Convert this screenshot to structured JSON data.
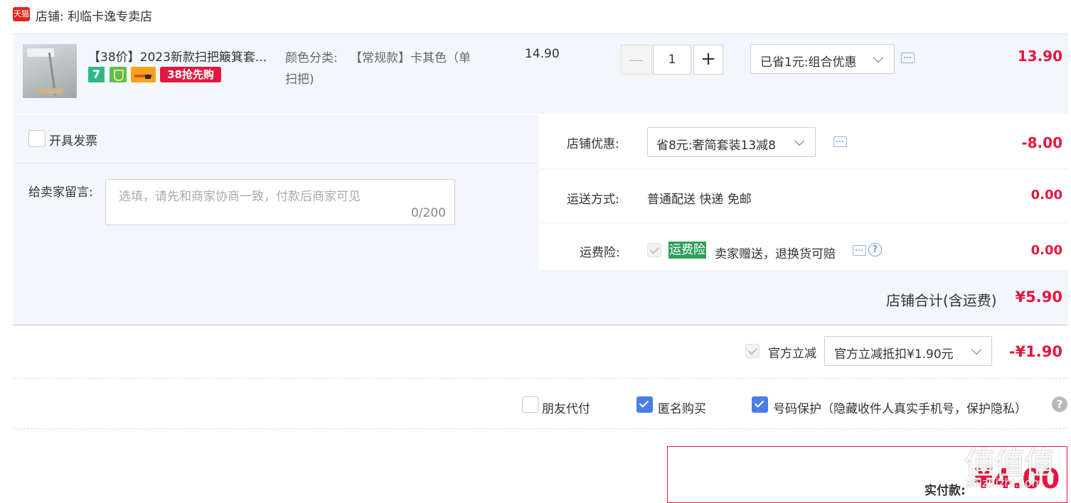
{
  "store": {
    "logo": "天猫",
    "name": "店铺: 利临卡逸专卖店"
  },
  "item": {
    "title": "【38价】2023新款扫把簸箕套...",
    "badge_seven": "7",
    "promo_badge": "38抢先购",
    "sku_label": "颜色分类:",
    "sku_value_line1": "【常规款】卡其色（单",
    "sku_value_line2": "扫把)",
    "unit_price": "14.90",
    "quantity": "1",
    "minus": "—",
    "plus": "+",
    "discount_select": "已省1元:组合优惠",
    "subtotal": "13.90"
  },
  "invoice": {
    "label": "开具发票"
  },
  "message": {
    "label": "给卖家留言:",
    "placeholder": "选填，请先和商家协商一致，付款后商家可见",
    "counter": "0/200"
  },
  "store_discount": {
    "label": "店铺优惠:",
    "select": "省8元:奢简套装13减8",
    "amount": "-8.00"
  },
  "shipping": {
    "label": "运送方式:",
    "value": "普通配送 快递 免邮",
    "amount": "0.00"
  },
  "insurance": {
    "label": "运费险:",
    "tag": "运费险",
    "text": "卖家赠送，退换货可赔",
    "amount": "0.00"
  },
  "store_total": {
    "label": "店铺合计(含运费)",
    "amount": "¥5.90"
  },
  "official": {
    "label": "官方立减",
    "select": "官方立减抵扣¥1.90元",
    "amount": "-¥1.90"
  },
  "options": {
    "friend_pay": "朋友代付",
    "anonymous": "匿名购买",
    "number_protect": "号码保护（隐藏收件人真实手机号，保护隐私）"
  },
  "payment": {
    "label": "实付款:",
    "amount": "¥4.00"
  },
  "watermark": {
    "text": "值值值",
    "sub": "zhizhizhi.com"
  },
  "colors": {
    "price_red": "#e4173e",
    "tmall_red": "#e1251b",
    "blue_check": "#4a7ee5",
    "insurance_green": "#2fa05b",
    "panel_bg": "#f3f6fc"
  }
}
